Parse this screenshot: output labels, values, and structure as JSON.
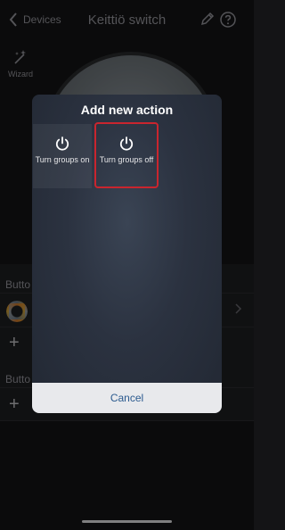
{
  "nav": {
    "back_label": "Devices",
    "title": "Keittiö switch",
    "edit_icon": "pencil-icon",
    "help_icon": "help-icon"
  },
  "wizard": {
    "label": "Wizard",
    "icon": "magic-wand-icon"
  },
  "sections": [
    {
      "label": "Butto"
    },
    {
      "label": "Butto"
    }
  ],
  "modal": {
    "title": "Add new action",
    "options": [
      {
        "label": "Turn groups on",
        "icon": "power-icon",
        "selected": false
      },
      {
        "label": "Turn groups off",
        "icon": "power-icon",
        "selected": true
      }
    ],
    "cancel_label": "Cancel"
  },
  "colors": {
    "accent_selected": "#c9252e",
    "cancel_text": "#2c5b8f",
    "background": "#141416"
  }
}
